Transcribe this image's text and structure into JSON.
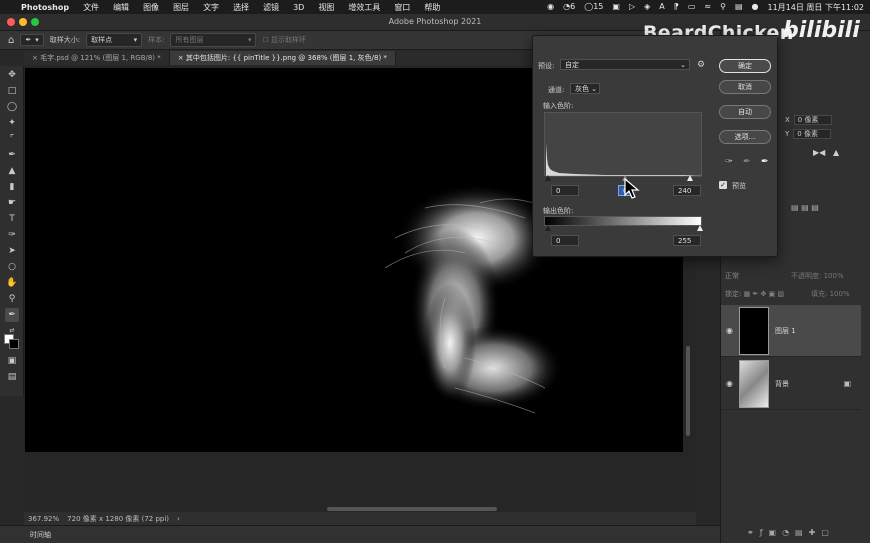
{
  "menubar": {
    "apple": "",
    "app": "Photoshop",
    "items": [
      "文件",
      "编辑",
      "图像",
      "图层",
      "文字",
      "选择",
      "滤镜",
      "3D",
      "视图",
      "增效工具",
      "窗口",
      "帮助"
    ],
    "status_count_1": "6",
    "status_count_2": "15",
    "datetime": "11月14日 周日 下午11:02"
  },
  "window": {
    "title": "Adobe Photoshop 2021"
  },
  "options": {
    "sample_size_label": "取样大小:",
    "sample_size_value": "取样点",
    "sample_label": "样本:",
    "sample_value": "所有图层",
    "show_ring": "显示取样环"
  },
  "tabs": [
    "毛字.psd @ 121% (图层 1, RGB/8) *",
    "其中包括图片: {{ pinTitle }}.png @ 368% (图层 1, 灰色/8) *"
  ],
  "status": {
    "zoom": "367.92%",
    "doc_info": "720 像素 x 1280 像素 (72 ppi)",
    "timeline": "时间轴"
  },
  "properties": {
    "x_label": "X",
    "x_value": "0 像素",
    "y_label": "Y",
    "y_value": "0 像素"
  },
  "layers": {
    "blend_mode": "正常",
    "opacity_label": "不透明度:",
    "opacity_value": "100%",
    "lock_label": "锁定:",
    "fill_label": "填充:",
    "fill_value": "100%",
    "items": [
      {
        "name": "图层 1",
        "selected": true
      },
      {
        "name": "背景",
        "selected": false
      }
    ]
  },
  "watermark": {
    "text": "BeardChicken",
    "logo": "bilibili"
  },
  "levels": {
    "preset_label": "预设:",
    "preset_value": "自定",
    "channel_label": "通道:",
    "channel_value": "灰色",
    "input_label": "输入色阶:",
    "input_black": "0",
    "input_gamma": "0.",
    "input_white": "240",
    "output_label": "输出色阶:",
    "output_black": "0",
    "output_white": "255",
    "ok": "确定",
    "cancel": "取消",
    "auto": "自动",
    "options": "选项...",
    "preview": "预览",
    "preview_checked": true
  }
}
